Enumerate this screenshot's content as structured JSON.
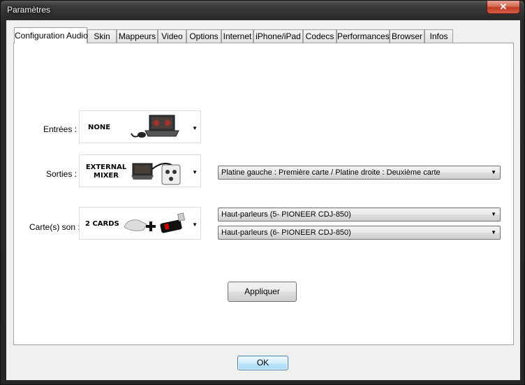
{
  "window": {
    "title": "Paramètres",
    "close_glyph": "✕"
  },
  "tabs": [
    {
      "label": "Configuration Audio",
      "active": true
    },
    {
      "label": "Skin"
    },
    {
      "label": "Mappeurs"
    },
    {
      "label": "Video"
    },
    {
      "label": "Options"
    },
    {
      "label": "Internet"
    },
    {
      "label": "iPhone/iPad"
    },
    {
      "label": "Codecs"
    },
    {
      "label": "Performances"
    },
    {
      "label": "Browser"
    },
    {
      "label": "Infos"
    }
  ],
  "audio": {
    "entrees": {
      "label": "Entrées :",
      "selected": "NONE"
    },
    "sorties": {
      "label": "Sorties :",
      "selected_line1": "EXTERNAL",
      "selected_line2": "MIXER",
      "mode": "Platine gauche : Première carte / Platine droite : Deuxième carte"
    },
    "cartes": {
      "label": "Carte(s) son :",
      "selected": "2 CARDS",
      "card1": "Haut-parleurs (5- PIONEER CDJ-850)",
      "card2": "Haut-parleurs (6- PIONEER CDJ-850)"
    },
    "apply_label": "Appliquer"
  },
  "footer": {
    "ok_label": "OK"
  },
  "icons": {
    "dropdown": "chevron-down-icon",
    "laptop": "laptop-icon",
    "mixer": "mixer-icon",
    "soundcard": "usb-soundcard-icon",
    "plus": "plus-icon"
  }
}
